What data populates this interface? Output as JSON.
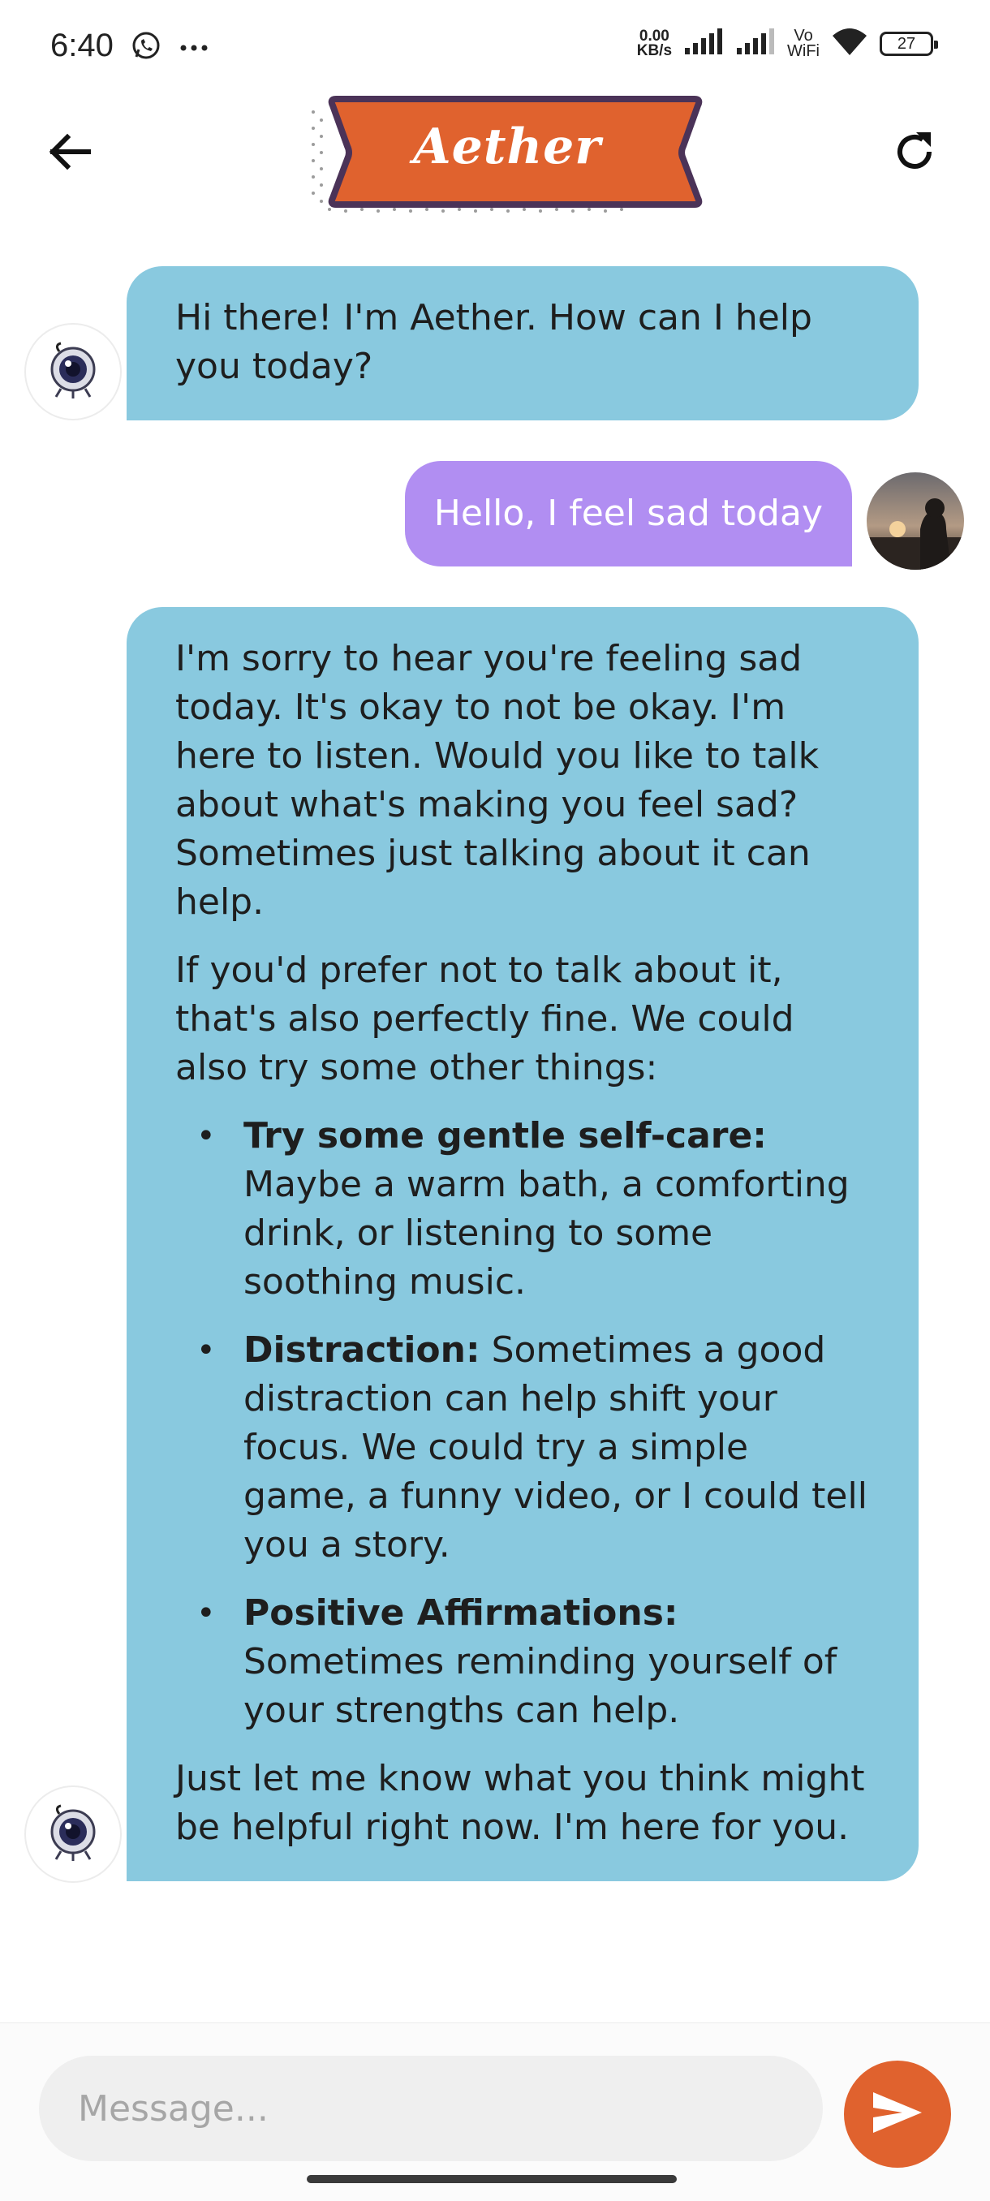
{
  "status_bar": {
    "time": "6:40",
    "net_speed_value": "0.00",
    "net_speed_unit": "KB/s",
    "vowifi_top": "Vo",
    "vowifi_bottom": "WiFi",
    "battery": "27",
    "icons": [
      "whatsapp-icon",
      "more-dots-icon",
      "signal-icon",
      "signal-icon",
      "wifi-icon",
      "battery-icon"
    ]
  },
  "header": {
    "title": "Aether",
    "back_icon": "arrow-left-icon",
    "refresh_icon": "refresh-icon"
  },
  "colors": {
    "bot_bubble": "#89c9df",
    "user_bubble": "#b18ef2",
    "logo_ribbon": "#e0622e",
    "logo_border": "#4b3358",
    "send_button": "#e0622e"
  },
  "messages": [
    {
      "sender": "bot",
      "text": "Hi there! I'm Aether. How can I help you today?"
    },
    {
      "sender": "user",
      "text": "Hello, I feel sad today"
    },
    {
      "sender": "bot",
      "intro_1": "I'm sorry to hear you're feeling sad today. It's okay to not be okay. I'm here to listen. Would you like to talk about what's making you feel sad? Sometimes just talking about it can help.",
      "intro_2": "If you'd prefer not to talk about it, that's also perfectly fine. We could also try some other things:",
      "tips": [
        {
          "title": "Try some gentle self-care:",
          "body": " Maybe a warm bath, a comforting drink, or listening to some soothing music."
        },
        {
          "title": "Distraction:",
          "body": " Sometimes a good distraction can help shift your focus. We could try a simple game, a funny video, or I could tell you a story."
        },
        {
          "title": "Positive Affirmations:",
          "body": " Sometimes reminding yourself of your strengths can help."
        }
      ],
      "outro": "Just let me know what you think might be helpful right now. I'm here for you."
    }
  ],
  "composer": {
    "placeholder": "Message...",
    "value": "",
    "send_icon": "send-icon"
  }
}
